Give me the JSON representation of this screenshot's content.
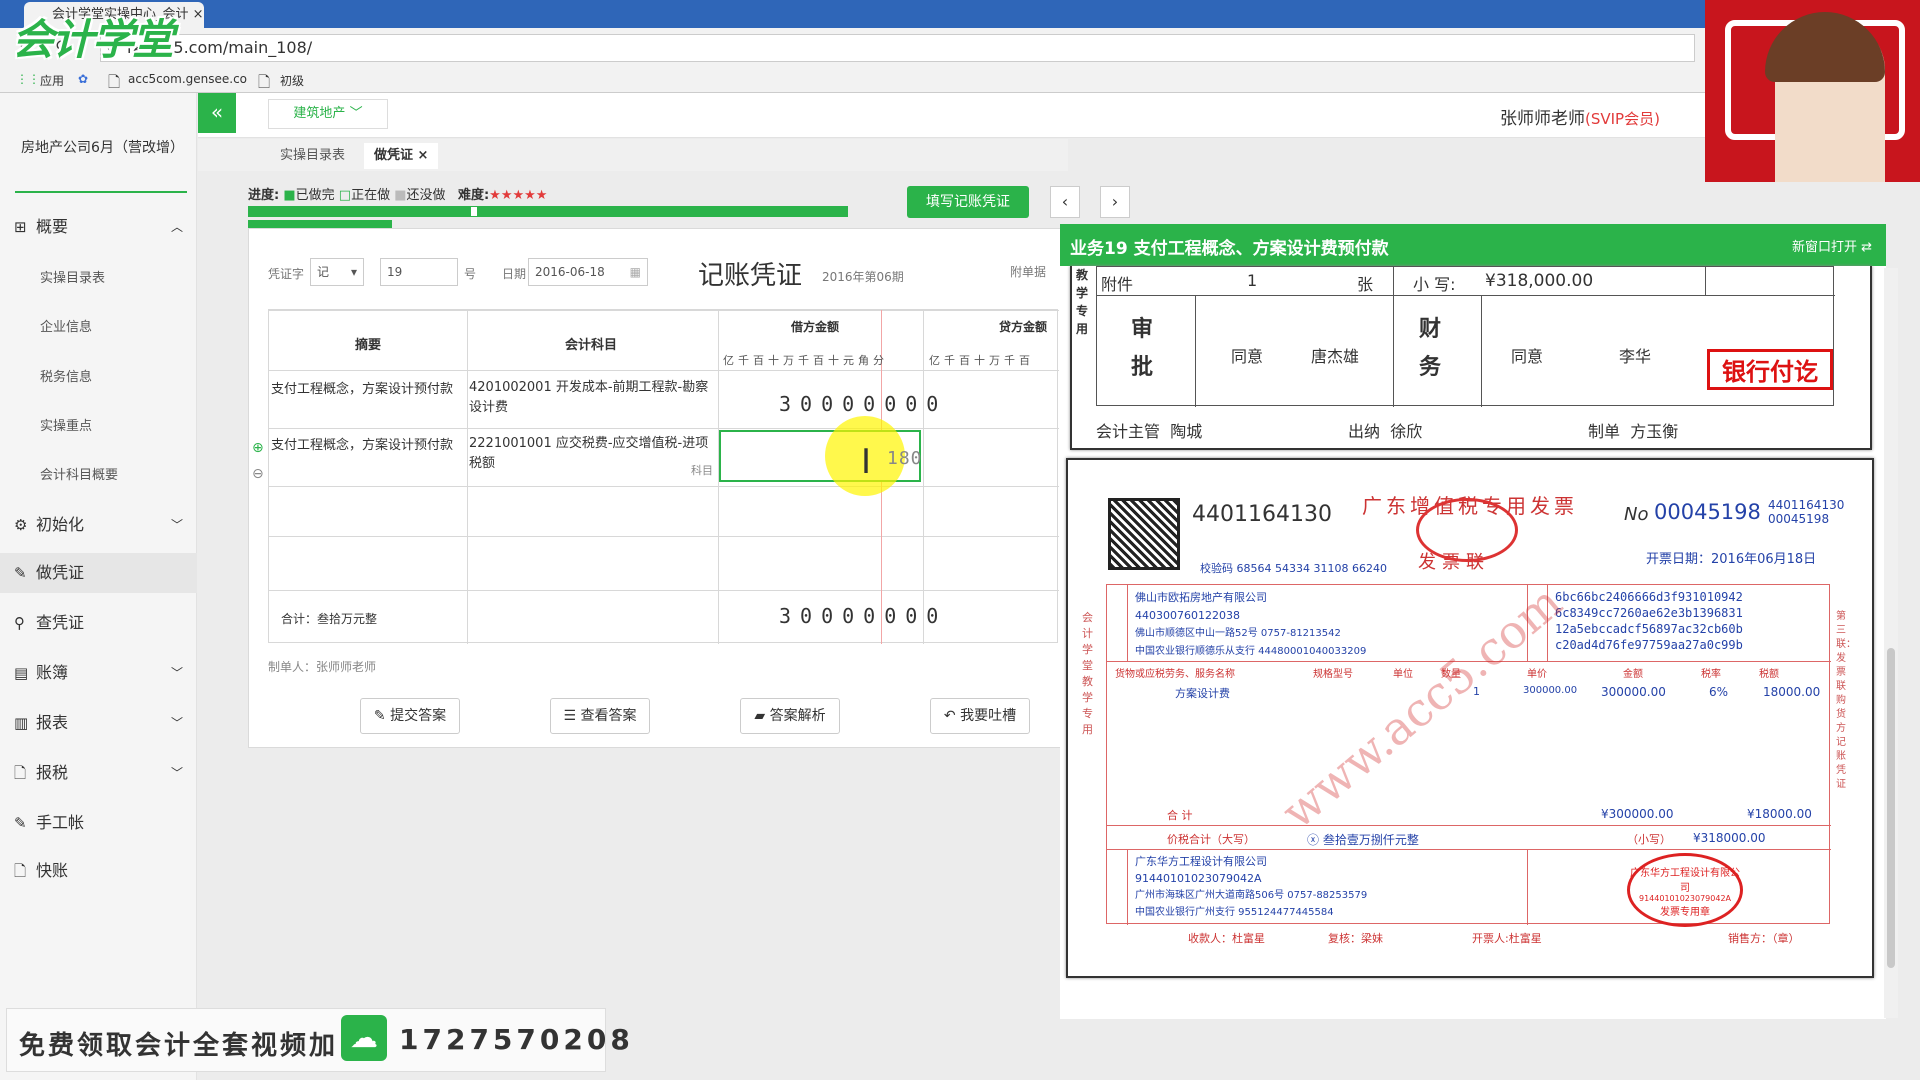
{
  "browser": {
    "tab_title": "会计学堂实操中心_会计",
    "url": "lx.acc5.com/main_108/",
    "bookmarks": [
      "应用",
      "acc5com.gensee.co",
      "初级"
    ]
  },
  "brand": {
    "logo_text": "会计学堂",
    "accent": "#2bb34a"
  },
  "sidebar": {
    "company": "房地产公司6月（营改增）",
    "items": [
      {
        "label": "概要",
        "icon": "grid-icon"
      },
      {
        "label": "初始化",
        "icon": "gear-icon"
      },
      {
        "label": "做凭证",
        "icon": "pen-icon"
      },
      {
        "label": "查凭证",
        "icon": "search-icon"
      },
      {
        "label": "账簿",
        "icon": "book-icon"
      },
      {
        "label": "报表",
        "icon": "report-icon"
      },
      {
        "label": "报税",
        "icon": "file-icon"
      },
      {
        "label": "手工帐",
        "icon": "pen-icon"
      },
      {
        "label": "快账",
        "icon": "file-icon"
      }
    ],
    "sub_items": [
      "实操目录表",
      "企业信息",
      "税务信息",
      "实操重点",
      "会计科目概要"
    ]
  },
  "header": {
    "industry": "建筑地产",
    "teacher": "张师师老师",
    "member": "(SVIP会员)"
  },
  "page_tabs": [
    "实操目录表",
    "做凭证"
  ],
  "progress": {
    "label": "进度:",
    "done": "已做完",
    "doing": "正在做",
    "todo": "还没做",
    "difficulty_label": "难度:",
    "difficulty": "★★★★★"
  },
  "actions": {
    "fill": "填写记账凭证",
    "prev": "‹",
    "next": "›",
    "submit": "提交答案",
    "view": "查看答案",
    "analysis": "答案解析",
    "feedback": "我要吐槽"
  },
  "voucher": {
    "type_label": "凭证字",
    "type_value": "记",
    "number": "19",
    "number_suffix": "号",
    "date_label": "日期",
    "date": "2016-06-18",
    "title": "记账凭证",
    "period": "2016年第06期",
    "attach_label": "附单据",
    "headers": {
      "summary": "摘要",
      "account": "会计科目",
      "debit": "借方金额",
      "credit": "贷方金额",
      "units": "亿千百十万千百十元角分",
      "credit_units": "亿千百十万千百"
    },
    "rows": [
      {
        "summary": "支付工程概念，方案设计预付款",
        "account": "4201002001 开发成本-前期工程款-勘察设计费",
        "debit": "30000000"
      },
      {
        "summary": "支付工程概念，方案设计预付款",
        "account": "2221001001 应交税费-应交增值税-进项税额",
        "account_hint": "科目",
        "debit": "180"
      }
    ],
    "total_label": "合计：叁拾万元整",
    "total_debit": "30000000",
    "maker": "制单人：张师师老师"
  },
  "invoice_panel": {
    "title": "业务19 支付工程概念、方案设计费预付款",
    "open_new": "新窗口打开",
    "approval": {
      "side_label": "教学专用",
      "attach_label": "附件",
      "attach_count": "1",
      "sheets": "张",
      "amount_label": "小  写:",
      "amount": "¥318,000.00",
      "approve": "审批",
      "agree1": "同意",
      "person1": "唐杰雄",
      "finance": "财务",
      "agree2": "同意",
      "person2": "李华",
      "stamp": "银行付讫",
      "supervisor_label": "会计主管",
      "supervisor": "陶城",
      "cashier_label": "出纳",
      "cashier": "徐欣",
      "maker_label": "制单",
      "maker": "方玉衡"
    },
    "invoice": {
      "code": "4401164130",
      "title": "广东增值税专用发票",
      "copy": "发票联",
      "no_label": "No",
      "no": "00045198",
      "code_small": "4401164130",
      "no_small": "00045198",
      "date": "开票日期：2016年06月18日",
      "check_code": "校验码 68564 54334 31108 66240",
      "buyer": {
        "name": "佛山市欧拓房地产有限公司",
        "tax_id": "440300760122038",
        "address": "佛山市顺德区中山一路52号 0757-81213542",
        "bank": "中国农业银行顺德乐从支行 44480001040033209"
      },
      "cipher": [
        "6bc66bc2406666d3f931010942",
        "6c8349cc7260ae62e3b1396831",
        "12a5ebccadcf56897ac32cb60b",
        "c20ad4d76fe97759aa27a0c99b"
      ],
      "item_headers": [
        "货物或应税劳务、服务名称",
        "规格型号",
        "单位",
        "数量",
        "单价",
        "金额",
        "税率",
        "税额"
      ],
      "item": {
        "name": "方案设计费",
        "qty": "1",
        "price": "300000.00",
        "amount": "300000.00",
        "rate": "6%",
        "tax": "18000.00"
      },
      "total_label": "合      计",
      "total_amount": "¥300000.00",
      "total_tax": "¥18000.00",
      "grand_label": "价税合计（大写）",
      "grand_words": "叁拾壹万捌仟元整",
      "grand_small_label": "（小写）",
      "grand_small": "¥318000.00",
      "seller": {
        "name": "广东华方工程设计有限公司",
        "tax_id": "91440101023079042A",
        "address": "广州市海珠区广州大道南路506号 0757-88253579",
        "bank": "中国农业银行广州支行 955124477445584"
      },
      "payee": "收款人：杜富星",
      "reviewer": "复核：梁妹",
      "issuer": "开票人:杜富星",
      "seller_note": "销售方：（章）",
      "seal_text": "广东华方工程设计有限公司",
      "seal_bottom": "发票专用章",
      "seal_id": "91440101023079042A",
      "side_left": "会计学堂教学专用",
      "side_right": "第三联：发票联 购货方记账凭证",
      "watermark": "www.acc5.com"
    }
  },
  "promo": {
    "text": "免费领取会计全套视频加",
    "phone": "1727570208"
  }
}
